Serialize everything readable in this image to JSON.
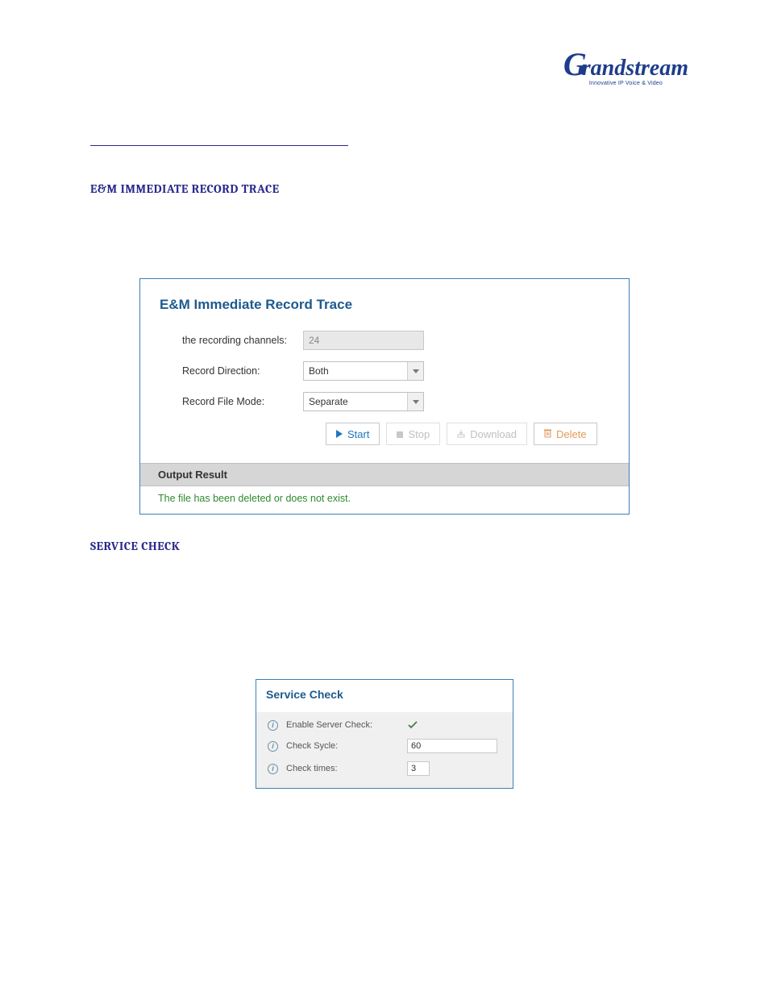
{
  "logo": {
    "brand": "Grandstream",
    "tagline": "Innovative IP Voice & Video"
  },
  "headings": {
    "em_trace": "E&M IMMEDIATE RECORD TRACE",
    "service_check": "SERVICE CHECK"
  },
  "panel_trace": {
    "title": "E&M Immediate Record Trace",
    "fields": {
      "channels_label": "the recording channels:",
      "channels_value": "24",
      "direction_label": "Record Direction:",
      "direction_value": "Both",
      "filemode_label": "Record File Mode:",
      "filemode_value": "Separate"
    },
    "buttons": {
      "start": "Start",
      "stop": "Stop",
      "download": "Download",
      "delete": "Delete"
    },
    "output": {
      "header": "Output Result",
      "message": "The file has been deleted or does not exist."
    }
  },
  "panel_service": {
    "title": "Service Check",
    "rows": {
      "enable_label": "Enable Server Check:",
      "cycle_label": "Check Sycle:",
      "cycle_value": "60",
      "times_label": "Check times:",
      "times_value": "3"
    }
  }
}
